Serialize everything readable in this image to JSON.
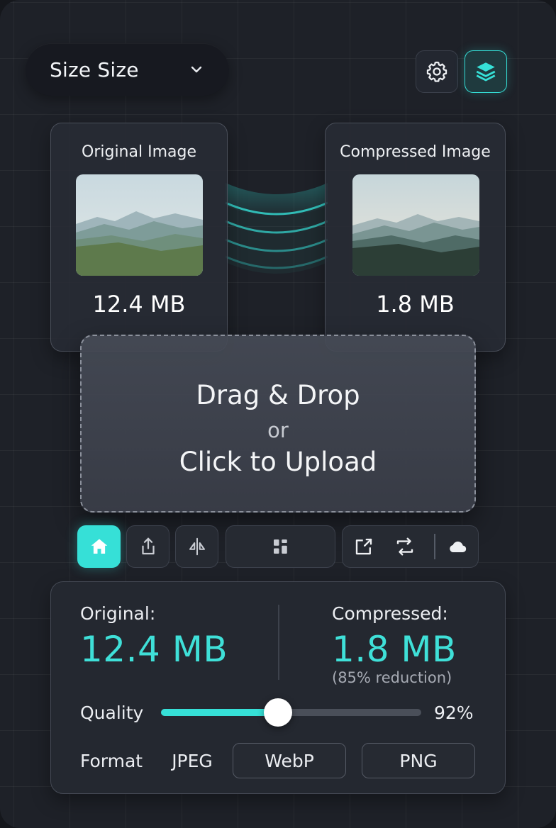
{
  "header": {
    "app_select_label": "Size Size",
    "icons": {
      "dropdown": "chevron-down-icon",
      "settings": "gear-icon",
      "layers": "layers-icon"
    },
    "accent_color": "#36e0d7"
  },
  "preview": {
    "original": {
      "title": "Original Image",
      "size": "12.4 MB"
    },
    "compressed": {
      "title": "Compressed Image",
      "size": "1.8 MB"
    }
  },
  "dropzone": {
    "line1": "Drag & Drop",
    "line2": "or",
    "line3": "Click to Upload"
  },
  "toolbar": {
    "items": [
      "home-icon",
      "share-icon",
      "compare-icon",
      "grid-icon",
      "crop-icon",
      "swap-icon",
      "cloud-icon"
    ],
    "active": "home-icon"
  },
  "stats": {
    "original_label": "Original:",
    "original_value": "12.4 MB",
    "compressed_label": "Compressed:",
    "compressed_value": "1.8 MB",
    "reduction": "(85% reduction)",
    "quality_label": "Quality",
    "quality_value": "92%",
    "quality_level": 0.45,
    "format_label": "Format",
    "formats": [
      "JPEG",
      "WebP",
      "PNG"
    ]
  }
}
